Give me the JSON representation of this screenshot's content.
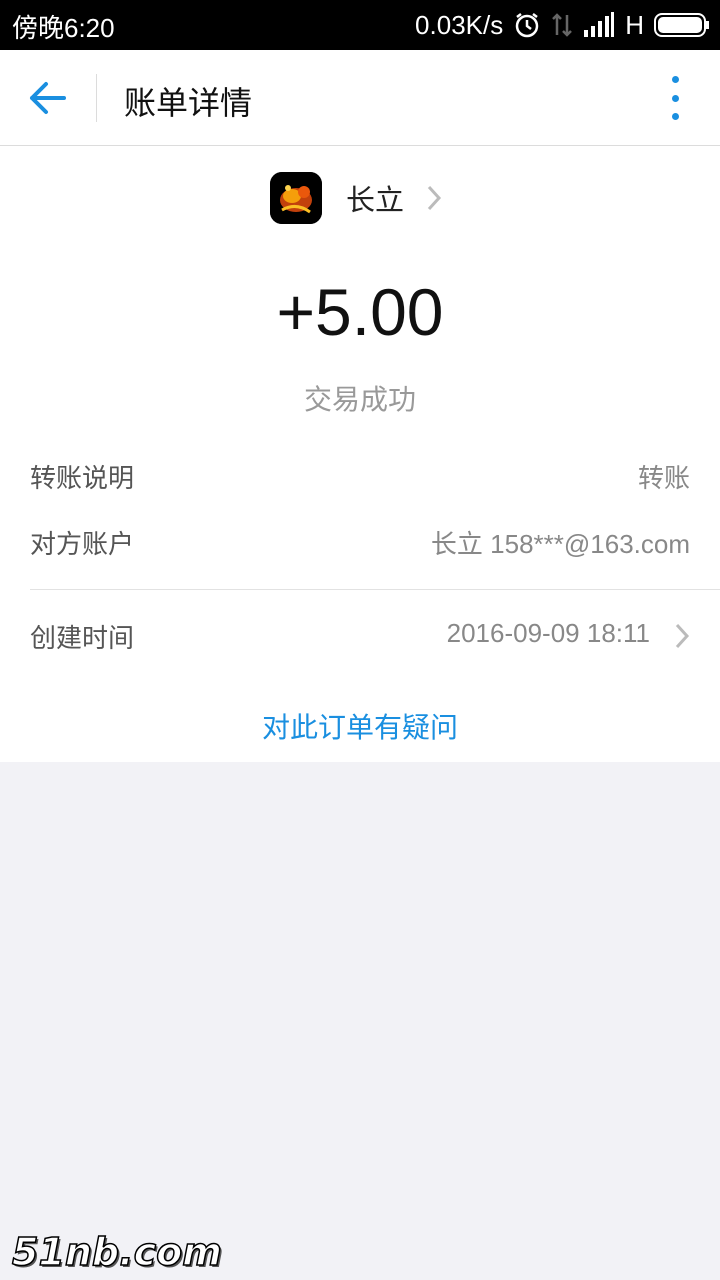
{
  "status_bar": {
    "time": "傍晚6:20",
    "network_speed": "0.03K/s",
    "network_type": "H",
    "icons": [
      "alarm-icon",
      "data-arrows-icon",
      "signal-icon",
      "battery-icon"
    ]
  },
  "header": {
    "title": "账单详情",
    "back_icon": "back-arrow-icon",
    "more_icon": "more-vertical-icon"
  },
  "counterparty": {
    "name": "长立",
    "avatar_icon": "avatar-image"
  },
  "transaction": {
    "amount": "+5.00",
    "status": "交易成功"
  },
  "details": {
    "description_label": "转账说明",
    "description_value": "转账",
    "account_label": "对方账户",
    "account_value": "长立 158***@163.com",
    "time_label": "创建时间",
    "time_value": "2016-09-09 18:11"
  },
  "actions": {
    "question_link": "对此订单有疑问"
  },
  "watermark": "51nb.com",
  "colors": {
    "accent": "#1a8fe0",
    "background": "#f2f2f6"
  }
}
